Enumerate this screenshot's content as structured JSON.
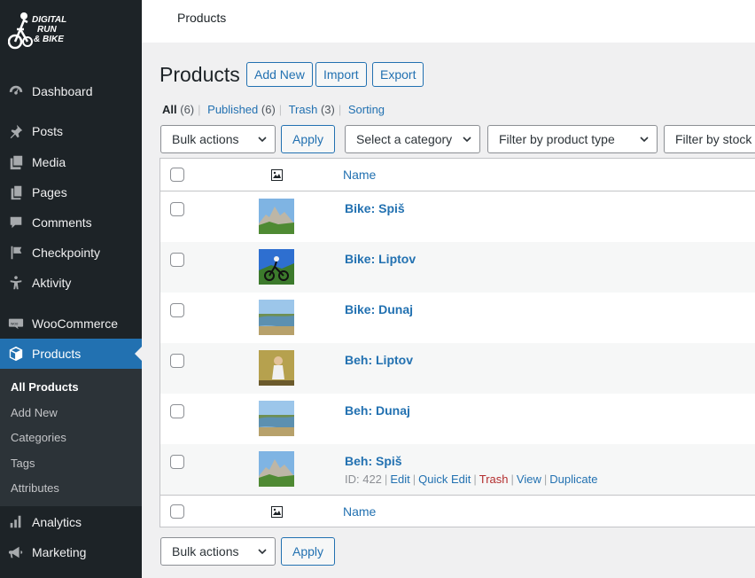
{
  "logo": {
    "line1": "DIGITAL",
    "line2": "RUN",
    "line3": "& BIKE"
  },
  "sidebar": {
    "items": [
      {
        "label": "Dashboard",
        "icon": "dashboard-icon"
      },
      {
        "label": "Posts",
        "icon": "pin-icon"
      },
      {
        "label": "Media",
        "icon": "media-icon"
      },
      {
        "label": "Pages",
        "icon": "pages-icon"
      },
      {
        "label": "Comments",
        "icon": "comment-icon"
      },
      {
        "label": "Checkpointy",
        "icon": "flag-icon"
      },
      {
        "label": "Aktivity",
        "icon": "person-icon"
      },
      {
        "label": "WooCommerce",
        "icon": "woo-icon"
      },
      {
        "label": "Products",
        "icon": "box-icon"
      },
      {
        "label": "Analytics",
        "icon": "chart-icon"
      },
      {
        "label": "Marketing",
        "icon": "megaphone-icon"
      }
    ],
    "submenu": [
      "All Products",
      "Add New",
      "Categories",
      "Tags",
      "Attributes"
    ]
  },
  "topbar": {
    "title": "Products"
  },
  "page": {
    "title": "Products",
    "add_new": "Add New",
    "import": "Import",
    "export": "Export"
  },
  "views": {
    "all": "All",
    "all_count": "(6)",
    "published": "Published",
    "published_count": "(6)",
    "trash": "Trash",
    "trash_count": "(3)",
    "sorting": "Sorting",
    "separator": "|"
  },
  "filters": {
    "bulk_actions": "Bulk actions",
    "apply": "Apply",
    "category": "Select a category",
    "product_type": "Filter by product type",
    "stock": "Filter by stock status"
  },
  "table": {
    "name_header": "Name",
    "rows": [
      {
        "name": "Bike: Spiš",
        "thumb": "mountain-photo"
      },
      {
        "name": "Bike: Liptov",
        "thumb": "cyclist-photo"
      },
      {
        "name": "Bike: Dunaj",
        "thumb": "river-photo"
      },
      {
        "name": "Beh: Liptov",
        "thumb": "runner-photo"
      },
      {
        "name": "Beh: Dunaj",
        "thumb": "river-photo"
      },
      {
        "name": "Beh: Spiš",
        "thumb": "mountain-photo"
      }
    ],
    "row_actions": {
      "id": "ID: 422",
      "edit": "Edit",
      "quick_edit": "Quick Edit",
      "trash": "Trash",
      "view": "View",
      "duplicate": "Duplicate",
      "separator": "|"
    }
  },
  "colors": {
    "sidebar_bg": "#1d2327",
    "accent": "#2271b1",
    "trash": "#b32d2e"
  }
}
